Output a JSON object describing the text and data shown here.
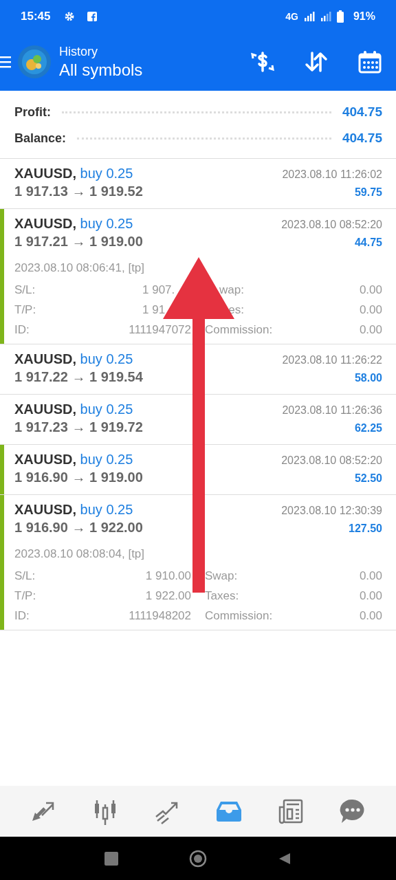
{
  "status_bar": {
    "time": "15:45",
    "network": "4G",
    "battery": "91%"
  },
  "header": {
    "title": "History",
    "subtitle": "All symbols"
  },
  "summary": [
    {
      "label": "Profit:",
      "value": "404.75"
    },
    {
      "label": "Balance:",
      "value": "404.75"
    }
  ],
  "deals": [
    {
      "symbol": "XAUUSD,",
      "type": "buy 0.25",
      "prices": "1 917.13 → 1 919.52",
      "time": "2023.08.10 11:26:02",
      "profit": "59.75",
      "highlighted": false
    },
    {
      "symbol": "XAUUSD,",
      "type": "buy 0.25",
      "prices": "1 917.21 → 1 919.00",
      "time": "2023.08.10 08:52:20",
      "profit": "44.75",
      "highlighted": true,
      "details": {
        "open": "2023.08.10 08:06:41, [tp]",
        "rows": [
          {
            "cells": [
              "S/L:",
              "1 907.",
              "wap:",
              "0.00"
            ],
            "cut": true
          },
          {
            "cells": [
              "T/P:",
              "1 91",
              "es:",
              "0.00"
            ],
            "cut": true
          },
          {
            "cells": [
              "ID:",
              "1111947072",
              "Commission:",
              "0.00"
            ],
            "cut": false
          }
        ]
      }
    },
    {
      "symbol": "XAUUSD,",
      "type": "buy 0.25",
      "prices": "1 917.22 → 1 919.54",
      "time": "2023.08.10 11:26:22",
      "profit": "58.00",
      "highlighted": false
    },
    {
      "symbol": "XAUUSD,",
      "type": "buy 0.25",
      "prices": "1 917.23 → 1 919.72",
      "time": "2023.08.10 11:26:36",
      "profit": "62.25",
      "highlighted": false
    },
    {
      "symbol": "XAUUSD,",
      "type": "buy 0.25",
      "prices": "1 916.90 → 1 919.00",
      "time": "2023.08.10 08:52:20",
      "profit": "52.50",
      "highlighted": true
    },
    {
      "symbol": "XAUUSD,",
      "type": "buy 0.25",
      "prices": "1 916.90 → 1 922.00",
      "time": "2023.08.10 12:30:39",
      "profit": "127.50",
      "highlighted": true,
      "details": {
        "open": "2023.08.10 08:08:04, [tp]",
        "rows": [
          {
            "cells": [
              "S/L:",
              "1 910.00",
              "Swap:",
              "0.00"
            ],
            "cut": false
          },
          {
            "cells": [
              "T/P:",
              "1 922.00",
              "Taxes:",
              "0.00"
            ],
            "cut": false
          },
          {
            "cells": [
              "ID:",
              "1111948202",
              "Commission:",
              "0.00"
            ],
            "cut": false
          }
        ]
      }
    }
  ],
  "bottom_nav": [
    {
      "kind": "trade",
      "selected": false
    },
    {
      "kind": "chart",
      "selected": false
    },
    {
      "kind": "trend",
      "selected": false
    },
    {
      "kind": "history",
      "selected": true
    },
    {
      "kind": "news",
      "selected": false
    },
    {
      "kind": "chat",
      "selected": false
    }
  ]
}
